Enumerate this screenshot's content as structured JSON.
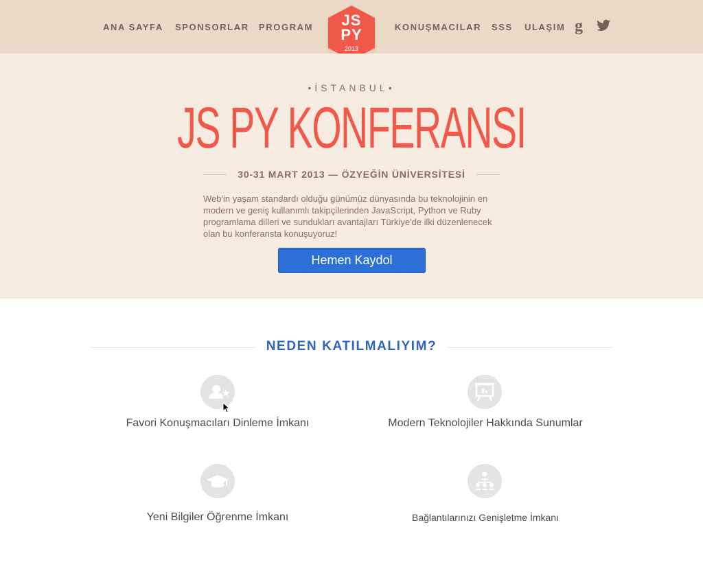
{
  "nav": {
    "items": [
      {
        "label": "ANA SAYFA"
      },
      {
        "label": "SPONSORLAR"
      },
      {
        "label": "PROGRAM"
      },
      {
        "label": "KONUŞMACILAR"
      },
      {
        "label": "SSS"
      },
      {
        "label": "ULAŞIM"
      }
    ],
    "social": [
      "google-plus-icon",
      "twitter-icon"
    ]
  },
  "logo": {
    "line1": "JS",
    "line2": "PY",
    "year": "2013",
    "color": "#f0594a"
  },
  "hero": {
    "city": "•İSTANBUL•",
    "title": "JS PY KONFERANSI",
    "dateline": "30-31 MART 2013 — ÖZYEĞİN ÜNİVERSİTESİ",
    "description": "Web'in yaşam standardı olduğu günümüz dünyasında bu teknolojinin en modern ve geniş kullanımlı takipçilerinden JavaScript, Python ve Ruby programlama dilleri ve sundukları avantajları Türkiye'de ilki düzenlenecek olan bu konferansta konuşuyoruz!",
    "cta": "Hemen Kaydol"
  },
  "why": {
    "title": "NEDEN KATILMALIYIM?",
    "features": [
      {
        "label": "Favori Konuşmacıları Dinleme İmkanı",
        "icon": "speaker-star-icon"
      },
      {
        "label": "Modern Teknolojiler Hakkında Sunumlar",
        "icon": "presentation-board-icon"
      },
      {
        "label": "Yeni Bilgiler Öğrenme İmkanı",
        "icon": "graduation-cap-icon"
      },
      {
        "label": "Bağlantılarınızı Genişletme İmkanı",
        "icon": "network-people-icon"
      }
    ]
  },
  "colors": {
    "accent": "#f0594a",
    "cta": "#2c6fd7",
    "heading_blue": "#2d65b8",
    "nav_bg": "#ead9c6",
    "hero_bg": "#f5ebe0"
  }
}
